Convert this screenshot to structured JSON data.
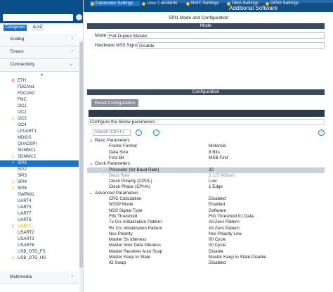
{
  "header": {
    "title": "SPI1 Mode and Configuration",
    "additional": "Additional Software"
  },
  "left": {
    "tabs": [
      "Categories",
      "A->Z"
    ],
    "sections": [
      {
        "label": "Analog"
      },
      {
        "label": "Timers"
      },
      {
        "label": "Connectivity"
      }
    ],
    "bottom_section": "Multimedia",
    "items": [
      {
        "label": "ETH",
        "icon": "ban"
      },
      {
        "label": "FDCAN1",
        "icon": ""
      },
      {
        "label": "FDCAN2",
        "icon": ""
      },
      {
        "label": "FMC",
        "icon": ""
      },
      {
        "label": "I2C1",
        "icon": ""
      },
      {
        "label": "I2C2",
        "icon": ""
      },
      {
        "label": "I2C3",
        "icon": "warn"
      },
      {
        "label": "I2C4",
        "icon": ""
      },
      {
        "label": "LPUART1",
        "icon": ""
      },
      {
        "label": "MDIOS",
        "icon": ""
      },
      {
        "label": "QUADSPI",
        "icon": ""
      },
      {
        "label": "SDMMC1",
        "icon": ""
      },
      {
        "label": "SDMMC2",
        "icon": "warn"
      },
      {
        "label": "SPI1",
        "icon": "check"
      },
      {
        "label": "SPI2",
        "icon": ""
      },
      {
        "label": "SPI3",
        "icon": ""
      },
      {
        "label": "SPI4",
        "icon": "warn"
      },
      {
        "label": "SPI6",
        "icon": "warn"
      },
      {
        "label": "SWPMI1",
        "icon": ""
      },
      {
        "label": "UART4",
        "icon": ""
      },
      {
        "label": "UART5",
        "icon": ""
      },
      {
        "label": "UART7",
        "icon": ""
      },
      {
        "label": "UART8",
        "icon": ""
      },
      {
        "label": "UART1",
        "icon": "check"
      },
      {
        "label": "USART2",
        "icon": ""
      },
      {
        "label": "USART3",
        "icon": ""
      },
      {
        "label": "USART6",
        "icon": ""
      },
      {
        "label": "USB_OTG_FS",
        "icon": ""
      },
      {
        "label": "USB_OTG_HS",
        "icon": "warn"
      }
    ]
  },
  "mode": {
    "bar": "Mode",
    "mode_label": "Mode",
    "mode_value": "Full-Duplex Master",
    "nss_label": "Hardware NSS Signal",
    "nss_value": "Disable"
  },
  "config": {
    "bar": "Configuration",
    "reset_button": "Reset Configuration",
    "tabs": [
      "Parameter Settings",
      "User Constants",
      "NVIC Settings",
      "DMA Settings",
      "GPIO Settings"
    ],
    "hint": "Configure the below parameters :",
    "search_placeholder": "Search (Ctrl+F)",
    "groups": [
      {
        "label": "Basic Parameters",
        "rows": [
          {
            "k": "Frame Format",
            "v": "Motorola"
          },
          {
            "k": "Data Size",
            "v": "8 Bits"
          },
          {
            "k": "First Bit",
            "v": "MSB First"
          }
        ]
      },
      {
        "label": "Clock Parameters",
        "rows": [
          {
            "k": "Prescaler (for Baud Rate)",
            "v": "32"
          },
          {
            "k": "Baud Rate",
            "v": "3.125 MBits/s"
          },
          {
            "k": "Clock Polarity (CPOL)",
            "v": "Low"
          },
          {
            "k": "Clock Phase (CPHA)",
            "v": "1 Edge"
          }
        ]
      },
      {
        "label": "Advanced Parameters",
        "rows": [
          {
            "k": "CRC Calculation",
            "v": "Disabled"
          },
          {
            "k": "NSSP Mode",
            "v": "Enabled"
          },
          {
            "k": "NSS Signal Type",
            "v": "Software"
          },
          {
            "k": "Fifo Threshold",
            "v": "Fifo Threshold 01 Data"
          },
          {
            "k": "Tx Crc Initialization Pattern",
            "v": "All Zero Pattern"
          },
          {
            "k": "Rx Crc Initialization Pattern",
            "v": "All Zero Pattern"
          },
          {
            "k": "Nss Polarity",
            "v": "Nss Polarity Low"
          },
          {
            "k": "Master Ss Idleness",
            "v": "00 Cycle"
          },
          {
            "k": "Master Inter Data Idleness",
            "v": "00 Cycle"
          },
          {
            "k": "Master Receiver Auto Susp",
            "v": "Disable"
          },
          {
            "k": "Master Keep Io State",
            "v": "Master Keep Io State Disable"
          },
          {
            "k": "IO Swap",
            "v": "Disabled"
          }
        ]
      }
    ]
  },
  "colors": {
    "accent": "#1a73c8",
    "header": "#0b4f8a",
    "bar": "#3a4a5c",
    "warn": "#f5c518"
  }
}
